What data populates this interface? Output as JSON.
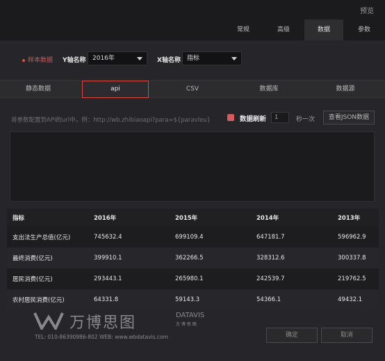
{
  "topbar": {
    "preview_label": "预览"
  },
  "nav_tabs": [
    {
      "label": "常规"
    },
    {
      "label": "高级"
    },
    {
      "label": "数据"
    },
    {
      "label": "参数"
    }
  ],
  "sample": {
    "label": "样本数据"
  },
  "y_axis": {
    "label": "Y轴名称",
    "value": "2016年"
  },
  "x_axis": {
    "label": "X轴名称",
    "value": "指标"
  },
  "sub_tabs": [
    {
      "label": "静态数据"
    },
    {
      "label": "api"
    },
    {
      "label": "CSV"
    },
    {
      "label": "数据库"
    },
    {
      "label": "数据源"
    }
  ],
  "api": {
    "hint": "将参数配置到API的url中，例：http://wb.zhibiaoapi?para=${paravleu}",
    "refresh_label": "数据刷新",
    "interval_value": "1",
    "interval_unit": "秒一次",
    "json_button": "查看JSON数据"
  },
  "table": {
    "headers": [
      "指标",
      "2016年",
      "2015年",
      "2014年",
      "2013年"
    ],
    "rows": [
      [
        "支出法生产总值(亿元)",
        "745632.4",
        "699109.4",
        "647181.7",
        "596962.9"
      ],
      [
        "最终消费(亿元)",
        "399910.1",
        "362266.5",
        "328312.6",
        "300337.8"
      ],
      [
        "居民消费(亿元)",
        "293443.1",
        "265980.1",
        "242539.7",
        "219762.5"
      ],
      [
        "农村居民消费(亿元)",
        "64331.8",
        "59143.3",
        "54366.1",
        "49432.1"
      ]
    ]
  },
  "footer": {
    "confirm": "确定",
    "cancel": "取消"
  },
  "watermark": {
    "brand": "万博思图",
    "datavis": "DATAVIS",
    "datavis_cn": "万 博 思 图",
    "contact": "TEL: 010-86390986-802  WEB: www.wbdatavis.com"
  }
}
